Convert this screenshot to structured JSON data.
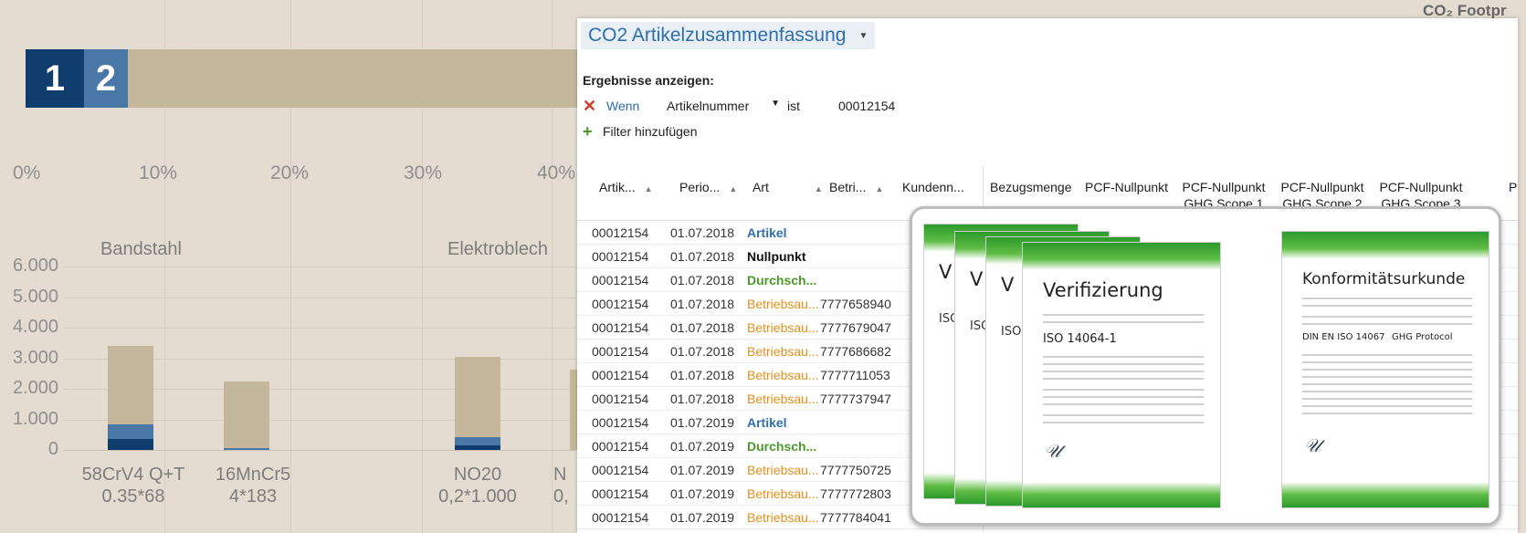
{
  "background_chart": {
    "top_bar_segments": [
      {
        "label": "1",
        "color": "#0e3d6e"
      },
      {
        "label": "2",
        "color": "#4a78a6"
      }
    ],
    "percent_ticks": [
      "0%",
      "10%",
      "20%",
      "30%",
      "40%"
    ],
    "group_labels": [
      "Bandstahl",
      "Elektroblech"
    ],
    "y_ticks": [
      "6.000",
      "5.000",
      "4.000",
      "3.000",
      "2.000",
      "1.000",
      "0"
    ],
    "bar_values": [
      3400,
      2250,
      3050
    ],
    "x_labels": [
      {
        "line1": "58CrV4 Q+T",
        "line2": "0.35*68"
      },
      {
        "line1": "16MnCr5",
        "line2": "4*183"
      },
      {
        "line1": "NO20",
        "line2": "0,2*1.000"
      },
      {
        "line1": "N",
        "line2": "0,"
      }
    ],
    "right_fragment": "CO₂ Footpr"
  },
  "panel": {
    "title": "CO2 Artikelzusammenfassung",
    "results_label": "Ergebnisse anzeigen:",
    "filter": {
      "wenn": "Wenn",
      "field": "Artikelnummer",
      "op": "ist",
      "value": "00012154"
    },
    "add_filter": "Filter hinzufügen",
    "columns": [
      "Artik...",
      "Perio...",
      "Art",
      "Betri...",
      "Kundenn...",
      "Bezugsmenge",
      "PCF-Nullpunkt",
      "PCF-Nullpunkt GHG Scope 1",
      "PCF-Nullpunkt GHG Scope 2",
      "PCF-Nullpunkt GHG Scope 3",
      "P"
    ],
    "rows": [
      {
        "artikel": "00012154",
        "periode": "01.07.2018",
        "art": "Artikel",
        "betrieb": ""
      },
      {
        "artikel": "00012154",
        "periode": "01.07.2018",
        "art": "Nullpunkt",
        "betrieb": ""
      },
      {
        "artikel": "00012154",
        "periode": "01.07.2018",
        "art": "Durchsch...",
        "betrieb": ""
      },
      {
        "artikel": "00012154",
        "periode": "01.07.2018",
        "art": "Betriebsau...",
        "betrieb": "7777658940"
      },
      {
        "artikel": "00012154",
        "periode": "01.07.2018",
        "art": "Betriebsau...",
        "betrieb": "7777679047"
      },
      {
        "artikel": "00012154",
        "periode": "01.07.2018",
        "art": "Betriebsau...",
        "betrieb": "7777686682"
      },
      {
        "artikel": "00012154",
        "periode": "01.07.2018",
        "art": "Betriebsau...",
        "betrieb": "7777711053"
      },
      {
        "artikel": "00012154",
        "periode": "01.07.2018",
        "art": "Betriebsau...",
        "betrieb": "7777737947"
      },
      {
        "artikel": "00012154",
        "periode": "01.07.2019",
        "art": "Artikel",
        "betrieb": ""
      },
      {
        "artikel": "00012154",
        "periode": "01.07.2019",
        "art": "Durchsch...",
        "betrieb": ""
      },
      {
        "artikel": "00012154",
        "periode": "01.07.2019",
        "art": "Betriebsau...",
        "betrieb": "7777750725"
      },
      {
        "artikel": "00012154",
        "periode": "01.07.2019",
        "art": "Betriebsau...",
        "betrieb": "7777772803"
      },
      {
        "artikel": "00012154",
        "periode": "01.07.2019",
        "art": "Betriebsau...",
        "betrieb": "7777784041"
      }
    ],
    "art_colors": {
      "Artikel": "#2e6fb0",
      "Nullpunkt": "#111111",
      "Durchsch...": "#4a9a2a",
      "Betriebsau...": "#e0901c"
    }
  },
  "certificates": {
    "cert1_title": "Verifizierung",
    "cert1_std": "ISO 14064-1",
    "cert2_title": "Konformitätsurkunde",
    "cert2_std1": "DIN EN ISO 14067",
    "cert2_std2": "GHG Protocol",
    "back_fragment": "V",
    "back_std": "ISO"
  }
}
